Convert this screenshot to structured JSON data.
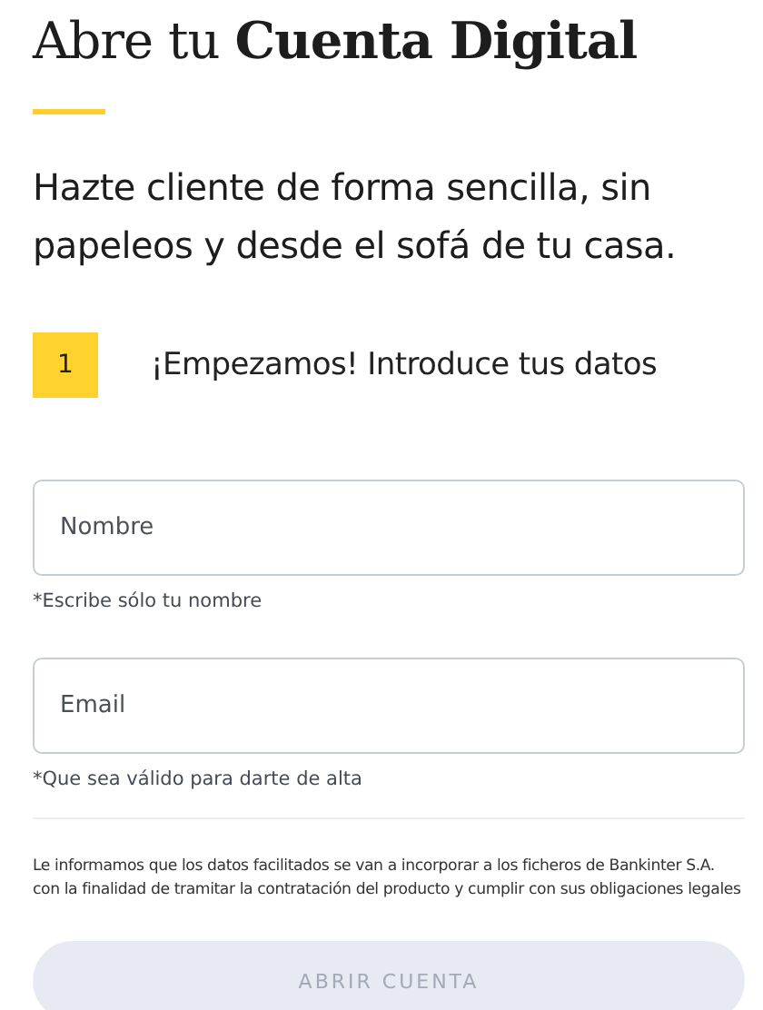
{
  "title": "Abre tu **Cuenta Digital**",
  "subtitle": "Hazte cliente de forma sencilla, sin papeleos y desde el sofá de tu casa.",
  "step": {
    "number": "1",
    "label": "¡Empezamos! Introduce tus datos"
  },
  "fields": [
    {
      "placeholder": "Nombre",
      "hint": "*Escribe sólo tu nombre"
    },
    {
      "placeholder": "Email",
      "hint": "*Que sea válido para darte de alta"
    }
  ],
  "legal": "Le informamos que los datos facilitados se van a incorporar a los ficheros de Bankinter S.A. con la finalidad de tramitar la contratación del producto y cumplir con sus obligaciones legales",
  "submit": {
    "label": "ABRIR CUENTA",
    "disabled": true
  }
}
